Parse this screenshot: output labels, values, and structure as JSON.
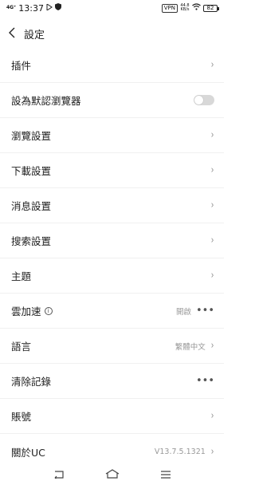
{
  "status_bar": {
    "signal": "4G⁺",
    "time": "13:37",
    "vpn": "VPN",
    "speed": "44.8",
    "speed_unit": "KB/s",
    "battery": "82"
  },
  "header": {
    "back_icon": "back-arrow-icon",
    "title": "設定"
  },
  "settings": {
    "plugins": "插件",
    "default_browser": "設為默認瀏覽器",
    "default_browser_enabled": false,
    "browse_settings": "瀏覽設置",
    "download_settings": "下載設置",
    "message_settings": "消息設置",
    "search_settings": "搜索設置",
    "theme": "主題",
    "cloud_accel": "雲加速",
    "cloud_accel_value": "開啟",
    "language": "語言",
    "language_value": "繁體中文",
    "clear_history": "清除記錄",
    "account": "賬號",
    "about": "關於UC",
    "about_value": "V13.7.5.1321"
  },
  "nav": {
    "back": "nav-back-icon",
    "home": "nav-home-icon",
    "menu": "nav-menu-icon"
  }
}
